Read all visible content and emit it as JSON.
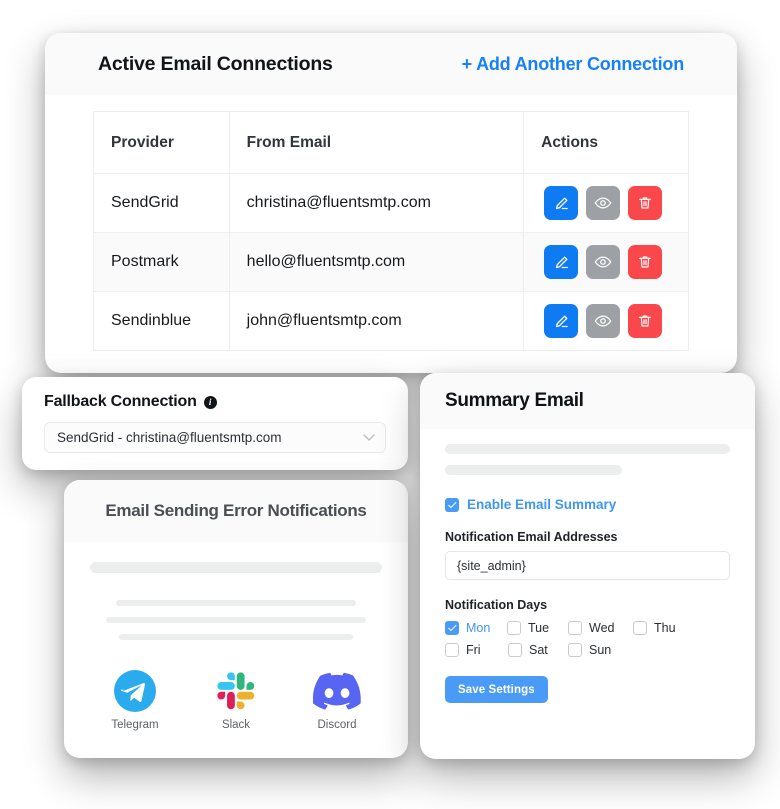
{
  "main": {
    "title": "Active Email Connections",
    "add_link": "+ Add Another Connection",
    "table": {
      "columns": [
        "Provider",
        "From Email",
        "Actions"
      ],
      "rows": [
        {
          "provider": "SendGrid",
          "email": "christina@fluentsmtp.com"
        },
        {
          "provider": "Postmark",
          "email": "hello@fluentsmtp.com"
        },
        {
          "provider": "Sendinblue",
          "email": "john@fluentsmtp.com"
        }
      ],
      "actions": [
        {
          "name": "edit-button",
          "icon": "pencil-icon",
          "color": "#0f7bf2"
        },
        {
          "name": "view-button",
          "icon": "eye-icon",
          "color": "#9da0a4"
        },
        {
          "name": "delete-button",
          "icon": "trash-icon",
          "color": "#f9474b"
        }
      ]
    }
  },
  "fallback": {
    "title": "Fallback Connection",
    "info_icon": "info-icon",
    "selected": "SendGrid - christina@fluentsmtp.com"
  },
  "errors": {
    "title": "Email Sending Error Notifications",
    "channels": [
      {
        "label": "Telegram",
        "icon": "telegram-icon",
        "color": "#2aabee"
      },
      {
        "label": "Slack",
        "icon": "slack-icon",
        "color": "#36c5f0"
      },
      {
        "label": "Discord",
        "icon": "discord-icon",
        "color": "#5865f2"
      }
    ]
  },
  "summary": {
    "title": "Summary Email",
    "enable_label": "Enable Email Summary",
    "enable_checked": true,
    "email_addresses_label": "Notification Email Addresses",
    "email_addresses_value": "{site_admin}",
    "notification_days_label": "Notification Days",
    "days_row1": [
      {
        "label": "Mon",
        "checked": true
      },
      {
        "label": "Tue",
        "checked": false
      },
      {
        "label": "Wed",
        "checked": false
      },
      {
        "label": "Thu",
        "checked": false
      }
    ],
    "days_row2": [
      {
        "label": "Fri",
        "checked": false
      },
      {
        "label": "Sat",
        "checked": false
      },
      {
        "label": "Sun",
        "checked": false
      }
    ],
    "save_label": "Save Settings"
  },
  "colors": {
    "accent_blue": "#1681f7",
    "button_blue": "#0f7bf2",
    "button_gray": "#9da0a4",
    "button_red": "#f9474b",
    "checkbox_blue": "#4a9bf5"
  }
}
